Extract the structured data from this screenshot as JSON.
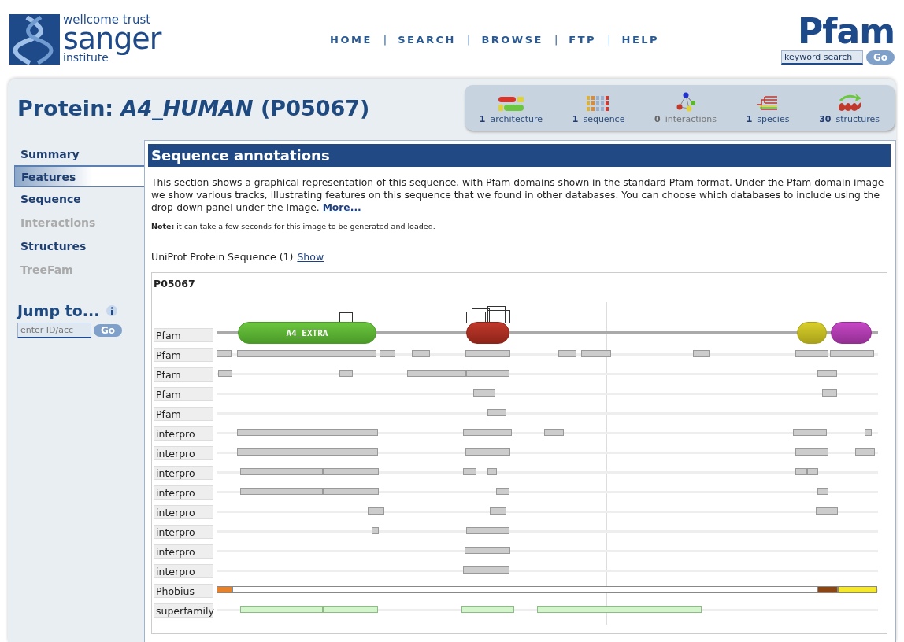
{
  "header": {
    "logo_lines": [
      "wellcome trust",
      "sanger",
      "institute"
    ],
    "nav": [
      {
        "kind": "link",
        "text": "HOME"
      },
      {
        "kind": "sep",
        "text": "|"
      },
      {
        "kind": "link",
        "text": "SEARCH"
      },
      {
        "kind": "sep",
        "text": "|"
      },
      {
        "kind": "link",
        "text": "BROWSE"
      },
      {
        "kind": "sep",
        "text": "|"
      },
      {
        "kind": "link",
        "text": "FTP"
      },
      {
        "kind": "sep",
        "text": "|"
      },
      {
        "kind": "link",
        "text": "HELP"
      }
    ],
    "pfam_logo": "Pfam",
    "search": {
      "value": "keyword search",
      "button": "Go"
    }
  },
  "title": "Protein: *A4_HUMAN* (P05067)",
  "stats": [
    {
      "kind": "architecture",
      "count": "1",
      "label": "architecture",
      "disabled": false
    },
    {
      "kind": "sequence",
      "count": "1",
      "label": "sequence",
      "disabled": false
    },
    {
      "kind": "interactions",
      "count": "0",
      "label": "interactions",
      "disabled": true
    },
    {
      "kind": "species",
      "count": "1",
      "label": "species",
      "disabled": false
    },
    {
      "kind": "structures",
      "count": "30",
      "label": "structures",
      "disabled": false
    }
  ],
  "sidebar": {
    "items": [
      {
        "label": "Summary",
        "selected": false,
        "disabled": false
      },
      {
        "label": "Features",
        "selected": true,
        "disabled": false
      },
      {
        "label": "Sequence",
        "selected": false,
        "disabled": false
      },
      {
        "label": "Interactions",
        "selected": false,
        "disabled": true
      },
      {
        "label": "Structures",
        "selected": false,
        "disabled": false
      },
      {
        "label": "TreeFam",
        "selected": false,
        "disabled": true
      }
    ],
    "jump": {
      "title": "Jump to...",
      "placeholder": "enter ID/acc",
      "button": "Go"
    }
  },
  "content": {
    "heading": "Sequence annotations",
    "intro": "This section shows a graphical representation of this sequence, with Pfam domains shown in the standard Pfam format. Under the Pfam domain image we show various tracks, illustrating features on this sequence that we found in other databases. You can choose which databases to include using the drop-down panel under the image.",
    "more_link": "More...",
    "note": "**Note:** it can take a few seconds for this image to be generated and loaded.",
    "uniprot_text": "UniProt Protein Sequence (1)",
    "show_link": "Show",
    "graphic": {
      "accession": "P05067",
      "domain_label": "A4_EXTRA",
      "tracks": [
        "Pfam",
        "Pfam",
        "Pfam",
        "Pfam",
        "Pfam",
        "interpro",
        "interpro",
        "interpro",
        "interpro",
        "interpro",
        "interpro",
        "interpro",
        "interpro",
        "Phobius",
        "superfamily"
      ]
    }
  }
}
